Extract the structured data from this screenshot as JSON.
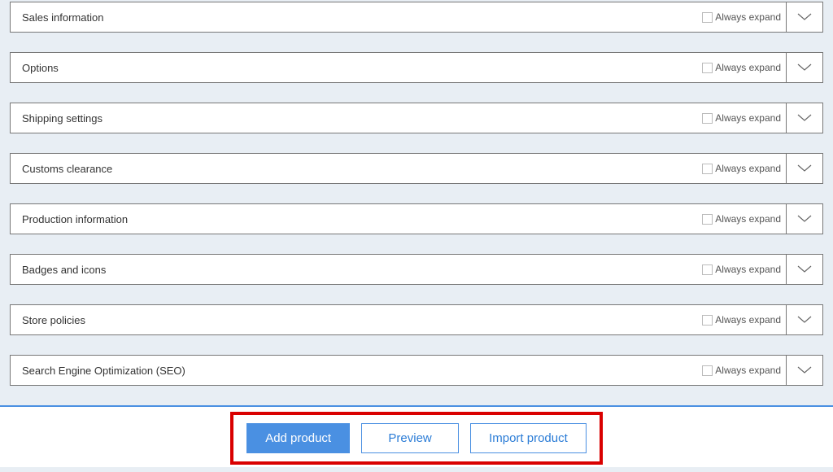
{
  "panels": [
    {
      "title": "Sales information",
      "always_expand_label": "Always expand"
    },
    {
      "title": "Options",
      "always_expand_label": "Always expand"
    },
    {
      "title": "Shipping settings",
      "always_expand_label": "Always expand"
    },
    {
      "title": "Customs clearance",
      "always_expand_label": "Always expand"
    },
    {
      "title": "Production information",
      "always_expand_label": "Always expand"
    },
    {
      "title": "Badges and icons",
      "always_expand_label": "Always expand"
    },
    {
      "title": "Store policies",
      "always_expand_label": "Always expand"
    },
    {
      "title": "Search Engine Optimization (SEO)",
      "always_expand_label": "Always expand"
    }
  ],
  "buttons": {
    "add_product": "Add product",
    "preview": "Preview",
    "import_product": "Import product"
  }
}
